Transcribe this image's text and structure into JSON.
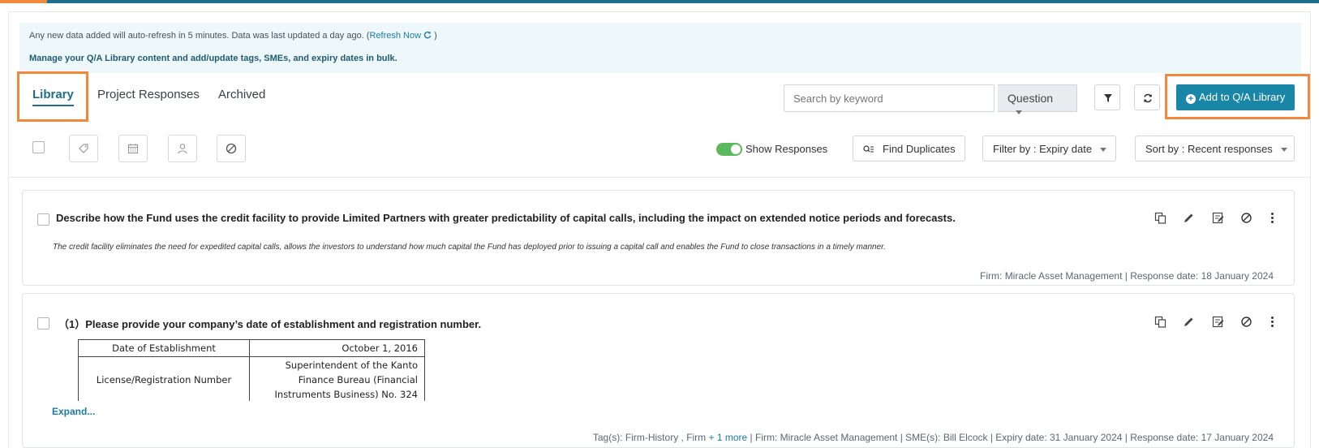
{
  "notice": {
    "auto_refresh": "Any new data added will auto-refresh in 5 minutes. Data was last updated a day ago. (",
    "refresh_link": "Refresh Now",
    "refresh_close": " )",
    "manage": "Manage your Q/A Library content and add/update tags, SMEs, and expiry dates in bulk."
  },
  "tabs": [
    {
      "label": "Library",
      "active": true
    },
    {
      "label": "Project Responses",
      "active": false
    },
    {
      "label": "Archived",
      "active": false
    }
  ],
  "search": {
    "placeholder": "Search by keyword",
    "type_value": "Question"
  },
  "add_button": "Add to Q/A Library",
  "toolbar": {
    "show_responses": "Show Responses",
    "show_responses_on": true,
    "find_duplicates": "Find Duplicates",
    "filter_by": "Filter by : Expiry date",
    "sort_by": "Sort by : Recent responses"
  },
  "cards": [
    {
      "question": "Describe how the Fund uses the credit facility to provide Limited Partners with greater predictability of capital calls, including the impact on extended notice periods and forecasts.",
      "answer": "The credit facility eliminates the need for expedited capital calls, allows the investors to understand how much capital the Fund has deployed prior to issuing a capital call and enables the Fund to close transactions in a timely manner.",
      "meta": "Firm: Miracle Asset Management | Response date: 18 January 2024"
    },
    {
      "question": "（1）Please provide your company’s date of establishment and registration number.",
      "table": [
        {
          "key": "Date of Establishment",
          "value": "October 1, 2016"
        },
        {
          "key": "License/Registration Number",
          "value": "Superintendent of the Kanto Finance Bureau (Financial Instruments Business) No. 324"
        }
      ],
      "expand": "Expand...",
      "meta_tags_prefix": "Tag(s):  Firm-History , Firm ",
      "meta_more": "+ 1 more",
      "meta_rest": " | Firm: Miracle Asset Management | SME(s):  Bill Elcock | Expiry date: 31 January 2024 | Response date: 17 January 2024"
    }
  ]
}
